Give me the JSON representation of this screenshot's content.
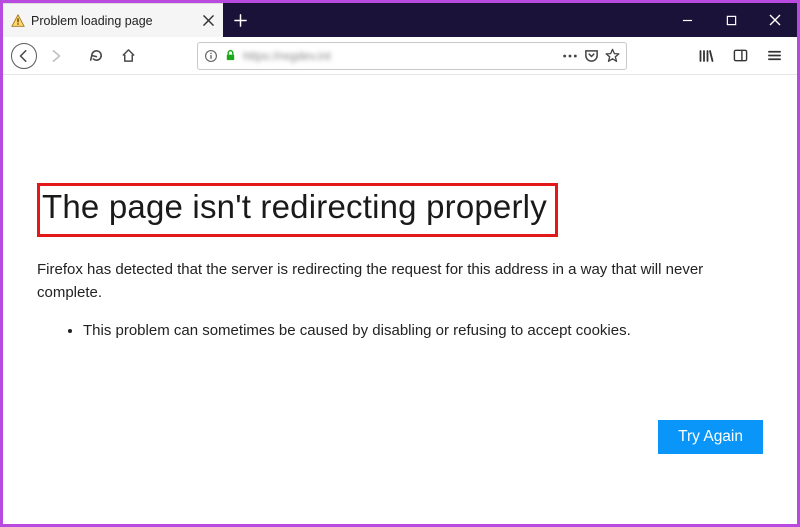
{
  "tab": {
    "title": "Problem loading page",
    "favicon": "warning-triangle"
  },
  "url": {
    "display": "https://regdev.int"
  },
  "error": {
    "heading": "The page isn't redirecting properly",
    "description": "Firefox has detected that the server is redirecting the request for this address in a way that will never complete.",
    "bullets": [
      "This problem can sometimes be caused by disabling or refusing to accept cookies."
    ],
    "button": "Try Again"
  }
}
